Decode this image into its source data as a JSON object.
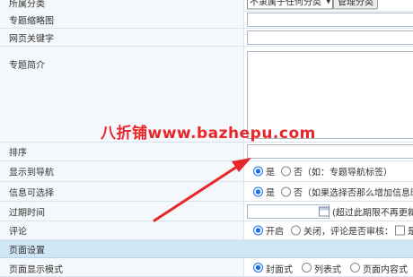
{
  "rows": {
    "category": {
      "label": "所属分类",
      "select_value": "不隶属于任何分类",
      "manage_button": "管理分类"
    },
    "thumbnail": {
      "label": "专题缩略图"
    },
    "keywords": {
      "label": "网页关键字"
    },
    "intro": {
      "label": "专题简介"
    },
    "sort": {
      "label": "排序"
    },
    "show_nav": {
      "label": "显示到导航",
      "yes": "是",
      "no": "否（如：专题导航标签）"
    },
    "info_select": {
      "label": "信息可选择",
      "yes": "是",
      "no": "否（如果选择否那么增加信息时"
    },
    "expire": {
      "label": "过期时间",
      "hint": "(超过此期限不再更新"
    },
    "comment": {
      "label": "评论",
      "on": "开启",
      "off": "关闭，评论是否审核：",
      "last": "是"
    },
    "page_settings": {
      "label": "页面设置"
    },
    "display_mode": {
      "label": "页面显示模式",
      "opt1": "封面式",
      "opt2": "列表式",
      "opt3": "页面内容式"
    }
  },
  "watermark": "八折铺www.bazhepu.com",
  "colors": {
    "accent": "#1a73e8",
    "watermark": "#e8262a",
    "section_bg": "#cfe6f5"
  }
}
